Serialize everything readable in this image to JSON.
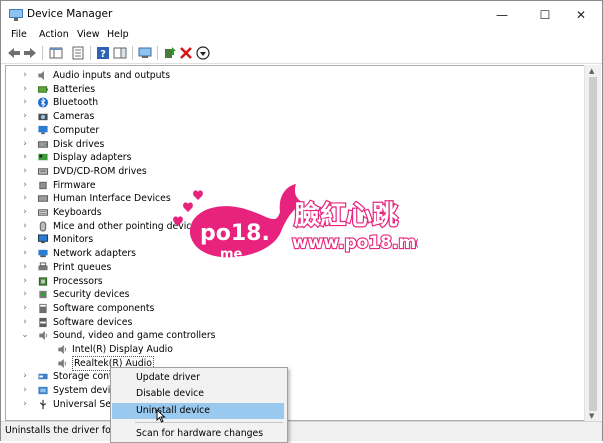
{
  "window": {
    "title": "Device Manager",
    "controls": {
      "minimize": "—",
      "maximize": "☐",
      "close": "✕"
    }
  },
  "menubar": [
    "File",
    "Action",
    "View",
    "Help"
  ],
  "tree": {
    "items": [
      {
        "label": "Audio inputs and outputs",
        "icon": "speaker-icon",
        "expanded": false
      },
      {
        "label": "Batteries",
        "icon": "battery-icon",
        "expanded": false
      },
      {
        "label": "Bluetooth",
        "icon": "bluetooth-icon",
        "expanded": false
      },
      {
        "label": "Cameras",
        "icon": "camera-icon",
        "expanded": false
      },
      {
        "label": "Computer",
        "icon": "computer-icon",
        "expanded": false
      },
      {
        "label": "Disk drives",
        "icon": "disk-icon",
        "expanded": false
      },
      {
        "label": "Display adapters",
        "icon": "display-adapter-icon",
        "expanded": false
      },
      {
        "label": "DVD/CD-ROM drives",
        "icon": "dvd-icon",
        "expanded": false
      },
      {
        "label": "Firmware",
        "icon": "firmware-icon",
        "expanded": false
      },
      {
        "label": "Human Interface Devices",
        "icon": "hid-icon",
        "expanded": false
      },
      {
        "label": "Keyboards",
        "icon": "keyboard-icon",
        "expanded": false
      },
      {
        "label": "Mice and other pointing devices",
        "icon": "mouse-icon",
        "expanded": false
      },
      {
        "label": "Monitors",
        "icon": "monitor-icon",
        "expanded": false
      },
      {
        "label": "Network adapters",
        "icon": "network-icon",
        "expanded": false
      },
      {
        "label": "Print queues",
        "icon": "printer-icon",
        "expanded": false
      },
      {
        "label": "Processors",
        "icon": "processor-icon",
        "expanded": false
      },
      {
        "label": "Security devices",
        "icon": "security-icon",
        "expanded": false
      },
      {
        "label": "Software components",
        "icon": "software-component-icon",
        "expanded": false
      },
      {
        "label": "Software devices",
        "icon": "software-device-icon",
        "expanded": false
      },
      {
        "label": "Sound, video and game controllers",
        "icon": "sound-icon",
        "expanded": true
      },
      {
        "label": "Intel(R) Display Audio",
        "icon": "sound-icon",
        "child": true
      },
      {
        "label": "Realtek(R) Audio",
        "icon": "sound-icon",
        "child": true,
        "selected": true
      },
      {
        "label": "Storage contro",
        "icon": "storage-icon",
        "expanded": false
      },
      {
        "label": "System device",
        "icon": "system-icon",
        "expanded": false
      },
      {
        "label": "Universal Seria",
        "icon": "usb-icon",
        "expanded": false
      }
    ]
  },
  "context_menu": {
    "items": [
      "Update driver",
      "Disable device",
      "Uninstall device",
      "Scan for hardware changes"
    ],
    "highlighted": "Uninstall device"
  },
  "status": {
    "text": "Uninstalls the driver for th"
  },
  "watermark": {
    "logo_text": "po18.me",
    "cjk_text": "臉紅心跳",
    "url_text": "www.po18.me"
  },
  "colors": {
    "highlight": "#99c9ef",
    "watermark_pink": "#e8237e"
  }
}
